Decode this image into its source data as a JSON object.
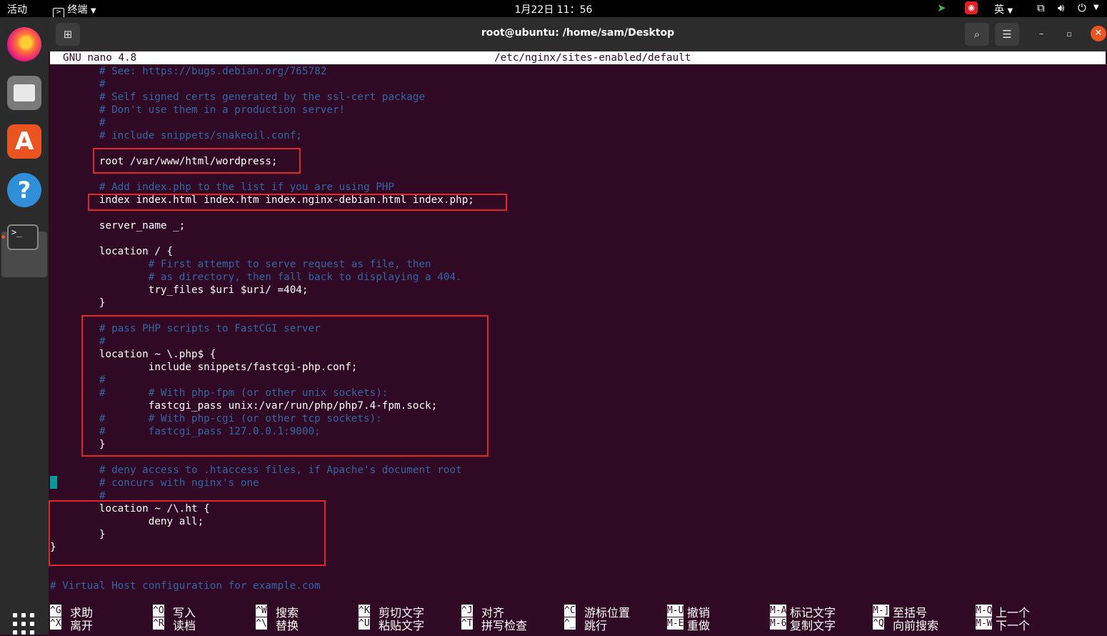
{
  "topbar": {
    "activities": "活动",
    "app_menu": "终端",
    "clock": "1月22日  11：56",
    "input_method": "英"
  },
  "window": {
    "title": "root@ubuntu: /home/sam/Desktop"
  },
  "nano": {
    "version": "GNU nano 4.8",
    "filename": "/etc/nginx/sites-enabled/default"
  },
  "editor": {
    "lines": [
      "        # See: https://bugs.debian.org/765782",
      "        #",
      "        # Self signed certs generated by the ssl-cert package",
      "        # Don't use them in a production server!",
      "        #",
      "        # include snippets/snakeoil.conf;",
      "",
      "        root /var/www/html/wordpress;",
      "",
      "        # Add index.php to the list if you are using PHP",
      "        index index.html index.htm index.nginx-debian.html index.php;",
      "",
      "        server_name _;",
      "",
      "        location / {",
      "                # First attempt to serve request as file, then",
      "                # as directory, then fall back to displaying a 404.",
      "                try_files $uri $uri/ =404;",
      "        }",
      "",
      "        # pass PHP scripts to FastCGI server",
      "        #",
      "        location ~ \\.php$ {",
      "                include snippets/fastcgi-php.conf;",
      "        #",
      "        #       # With php-fpm (or other unix sockets):",
      "                fastcgi_pass unix:/var/run/php/php7.4-fpm.sock;",
      "        #       # With php-cgi (or other tcp sockets):",
      "        #       fastcgi_pass 127.0.0.1:9000;",
      "        }",
      "",
      "        # deny access to .htaccess files, if Apache's document root",
      "        # concurs with nginx's one",
      "        #",
      "        location ~ /\\.ht {",
      "                deny all;",
      "        }",
      "}",
      "",
      "",
      "# Virtual Host configuration for example.com"
    ]
  },
  "shortcuts": [
    {
      "key": "^G",
      "label": "求助"
    },
    {
      "key": "^X",
      "label": "离开"
    },
    {
      "key": "^O",
      "label": "写入"
    },
    {
      "key": "^R",
      "label": "读档"
    },
    {
      "key": "^W",
      "label": "搜索"
    },
    {
      "key": "^\\",
      "label": "替换"
    },
    {
      "key": "^K",
      "label": "剪切文字"
    },
    {
      "key": "^U",
      "label": "粘贴文字"
    },
    {
      "key": "^J",
      "label": "对齐"
    },
    {
      "key": "^T",
      "label": "拼写检查"
    },
    {
      "key": "^C",
      "label": "游标位置"
    },
    {
      "key": "^_",
      "label": "跳行"
    },
    {
      "key": "M-U",
      "label": "撤销"
    },
    {
      "key": "M-E",
      "label": "重做"
    },
    {
      "key": "M-A",
      "label": "标记文字"
    },
    {
      "key": "M-6",
      "label": "复制文字"
    },
    {
      "key": "M-]",
      "label": "至括号"
    },
    {
      "key": "^Q",
      "label": "向前搜索"
    },
    {
      "key": "M-Q",
      "label": "上一个"
    },
    {
      "key": "M-W",
      "label": "下一个"
    }
  ],
  "colors": {
    "terminal_bg": "#300a24",
    "comment": "#3465a4",
    "highlight_box": "#e0262b",
    "cursor": "#06989a"
  }
}
